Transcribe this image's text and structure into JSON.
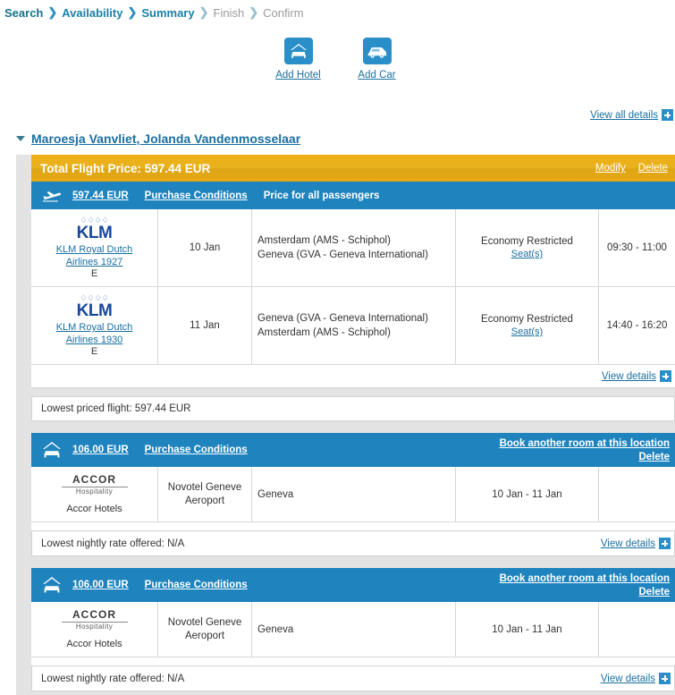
{
  "breadcrumb": {
    "items": [
      {
        "label": "Search",
        "state": "done"
      },
      {
        "label": "Availability",
        "state": "link"
      },
      {
        "label": "Summary",
        "state": "link"
      },
      {
        "label": "Finish",
        "state": "pending"
      },
      {
        "label": "Confirm",
        "state": "pending"
      }
    ],
    "separator": "❯"
  },
  "add_actions": [
    {
      "label": "Add Hotel",
      "icon": "hotel-bed-icon"
    },
    {
      "label": "Add Car",
      "icon": "car-icon"
    }
  ],
  "view_all_details": "View all details",
  "traveller": {
    "name": "Maroesja Vanvliet, Jolanda Vandenmosselaar"
  },
  "flight_block": {
    "total_label": "Total Flight Price: 597.44 EUR",
    "modify": "Modify",
    "delete": "Delete",
    "price": "597.44 EUR",
    "purchase_conditions": "Purchase Conditions",
    "price_note": "Price for all passengers",
    "view_details": "View details",
    "lowest": "Lowest priced flight: 597.44 EUR",
    "rows": [
      {
        "airline_logo": "KLM",
        "airline_name": "KLM Royal Dutch Airlines",
        "flight_number": "1927",
        "cabin_code": "E",
        "date": "10 Jan",
        "from": "Amsterdam (AMS - Schiphol)",
        "to": "Geneva (GVA - Geneva International)",
        "cabin": "Economy Restricted",
        "seats_link": "Seat(s)",
        "times": "09:30 - 11:00"
      },
      {
        "airline_logo": "KLM",
        "airline_name": "KLM Royal Dutch Airlines",
        "flight_number": "1930",
        "cabin_code": "E",
        "date": "11 Jan",
        "from": "Geneva (GVA - Geneva International)",
        "to": "Amsterdam (AMS - Schiphol)",
        "cabin": "Economy Restricted",
        "seats_link": "Seat(s)",
        "times": "14:40 - 16:20"
      }
    ]
  },
  "hotel_blocks": [
    {
      "price": "106.00 EUR",
      "purchase_conditions": "Purchase Conditions",
      "book_another": "Book another room at this location",
      "delete": "Delete",
      "chain_logo": "ACCOR",
      "chain_logo_sub": "Hospitality",
      "chain_name": "Accor Hotels",
      "hotel_name": "Novotel Geneve Aeroport",
      "city": "Geneva",
      "dates": "10 Jan - 11 Jan",
      "lowest": "Lowest nightly rate offered: N/A",
      "view_details": "View details"
    },
    {
      "price": "106.00 EUR",
      "purchase_conditions": "Purchase Conditions",
      "book_another": "Book another room at this location",
      "delete": "Delete",
      "chain_logo": "ACCOR",
      "chain_logo_sub": "Hospitality",
      "chain_name": "Accor Hotels",
      "hotel_name": "Novotel Geneve Aeroport",
      "city": "Geneva",
      "dates": "10 Jan - 11 Jan",
      "lowest": "Lowest nightly rate offered: N/A",
      "view_details": "View details"
    }
  ],
  "colors": {
    "accent_blue": "#1f84be",
    "gold": "#e8ae18",
    "link": "#1a6fa0",
    "klm_blue": "#16479d"
  }
}
